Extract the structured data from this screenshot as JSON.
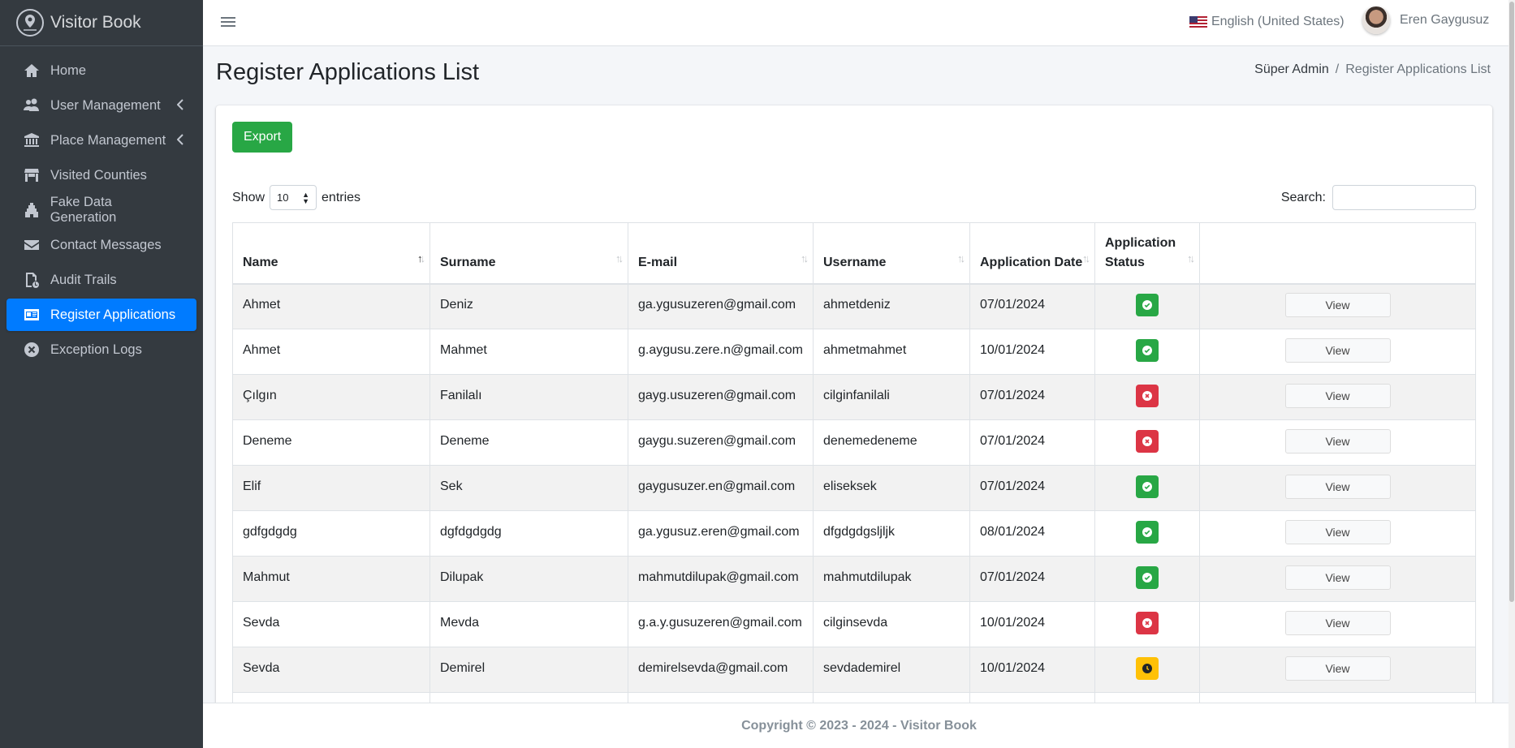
{
  "brand": {
    "title": "Visitor Book"
  },
  "sidebar": {
    "items": [
      {
        "label": "Home",
        "icon": "home-icon"
      },
      {
        "label": "User Management",
        "icon": "users-icon"
      },
      {
        "label": "Place Management",
        "icon": "landmark-icon"
      },
      {
        "label": "Visited Counties",
        "icon": "store-icon"
      },
      {
        "label": "Fake Data Generation",
        "icon": "gopuram-icon"
      },
      {
        "label": "Contact Messages",
        "icon": "envelope-icon"
      },
      {
        "label": "Audit Trails",
        "icon": "history-icon"
      },
      {
        "label": "Register Applications",
        "icon": "id-card-icon",
        "active": true
      },
      {
        "label": "Exception Logs",
        "icon": "times-circle-icon"
      }
    ]
  },
  "topbar": {
    "language": "English (United States)",
    "user_name": "Eren Gaygusuz"
  },
  "page": {
    "title": "Register Applications List",
    "breadcrumb": {
      "home": "Süper Admin",
      "separator": "/",
      "current": "Register Applications List"
    }
  },
  "toolbar": {
    "export_label": "Export",
    "show_label": "Show",
    "entries_value": "10",
    "entries_label": "entries",
    "search_label": "Search:"
  },
  "table": {
    "headers": {
      "name": "Name",
      "surname": "Surname",
      "email": "E-mail",
      "username": "Username",
      "date": "Application Date",
      "status_line1": "Application",
      "status_line2": "Status"
    },
    "view_label": "View",
    "rows": [
      {
        "name": "Ahmet",
        "surname": "Deniz",
        "email": "ga.ygusuzeren@gmail.com",
        "username": "ahmetdeniz",
        "date": "07/01/2024",
        "status": "approved"
      },
      {
        "name": "Ahmet",
        "surname": "Mahmet",
        "email": "g.aygusu.zere.n@gmail.com",
        "username": "ahmetmahmet",
        "date": "10/01/2024",
        "status": "approved"
      },
      {
        "name": "Çılgın",
        "surname": "Fanilalı",
        "email": "gayg.usuzeren@gmail.com",
        "username": "cilginfanilali",
        "date": "07/01/2024",
        "status": "rejected"
      },
      {
        "name": "Deneme",
        "surname": "Deneme",
        "email": "gaygu.suzeren@gmail.com",
        "username": "denemedeneme",
        "date": "07/01/2024",
        "status": "rejected"
      },
      {
        "name": "Elif",
        "surname": "Sek",
        "email": "gaygusuzer.en@gmail.com",
        "username": "eliseksek",
        "date": "07/01/2024",
        "status": "approved"
      },
      {
        "name": "gdfgdgdg",
        "surname": "dgfdgdgdg",
        "email": "ga.ygusuz.eren@gmail.com",
        "username": "dfgdgdgsljljk",
        "date": "08/01/2024",
        "status": "approved"
      },
      {
        "name": "Mahmut",
        "surname": "Dilupak",
        "email": "mahmutdilupak@gmail.com",
        "username": "mahmutdilupak",
        "date": "07/01/2024",
        "status": "approved"
      },
      {
        "name": "Sevda",
        "surname": "Mevda",
        "email": "g.a.y.gusuzeren@gmail.com",
        "username": "cilginsevda",
        "date": "10/01/2024",
        "status": "rejected"
      },
      {
        "name": "Sevda",
        "surname": "Demirel",
        "email": "demirelsevda@gmail.com",
        "username": "sevdademirel",
        "date": "10/01/2024",
        "status": "pending"
      },
      {
        "name": "",
        "surname": "",
        "email": "",
        "username": "",
        "date": "",
        "status": ""
      }
    ]
  },
  "status_colors": {
    "approved": "#28a745",
    "rejected": "#dc3545",
    "pending": "#ffc107"
  },
  "footer": {
    "text": "Copyright © 2023 - 2024 - Visitor Book"
  }
}
